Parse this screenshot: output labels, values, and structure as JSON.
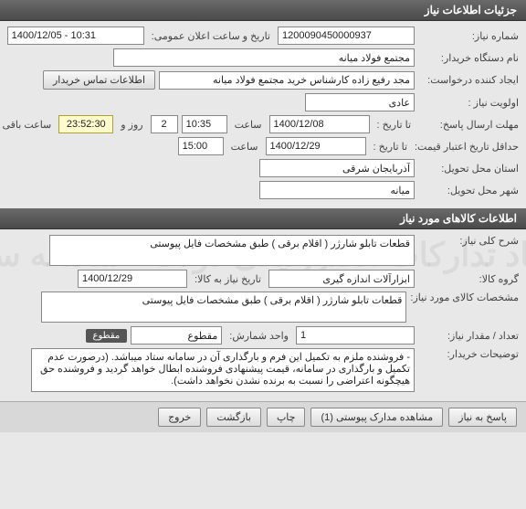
{
  "watermark": "ستاد تدارکات الکترونیکی دولت - سامانه ستاد",
  "header1": "جزئیات اطلاعات نیاز",
  "header2": "اطلاعات کالاهای مورد نیاز",
  "labels": {
    "need_no": "شماره نیاز:",
    "announce_dt": "تاریخ و ساعت اعلان عمومی:",
    "buyer_org": "نام دستگاه خریدار:",
    "requester": "ایجاد کننده درخواست:",
    "contact_btn": "اطلاعات تماس خریدار",
    "priority": "اولویت نیاز :",
    "resp_deadline": "مهلت ارسال پاسخ:",
    "until_date": "تا تاریخ :",
    "time": "ساعت",
    "days_and": "روز و",
    "remaining": "ساعت باقی مانده",
    "valid_until_lbl": "حداقل تاریخ اعتبار قیمت:",
    "valid_until_date": "تا تاریخ :",
    "delivery_province": "استان محل تحویل:",
    "delivery_city": "شهر محل تحویل:",
    "general_desc": "شرح کلی نیاز:",
    "goods_group": "گروه کالا:",
    "need_date": "تاریخ نیاز به کالا:",
    "item_spec": "مشخصات کالای مورد نیاز:",
    "qty": "تعداد / مقدار نیاز:",
    "unit": "واحد شمارش:",
    "cut": "مقطوع",
    "buyer_notes": "توضیحات خریدار:"
  },
  "values": {
    "need_no": "1200090450000937",
    "announce_dt": "1400/12/05 - 10:31",
    "buyer_org": "مجتمع فولاد میانه",
    "requester": "مجد رفیع زاده کارشناس خرید مجتمع فولاد میانه",
    "priority": "عادی",
    "resp_date": "1400/12/08",
    "resp_time": "10:35",
    "resp_days": "2",
    "resp_countdown": "23:52:30",
    "valid_date": "1400/12/29",
    "valid_time": "15:00",
    "province": "آذربایجان شرقی",
    "city": "میانه",
    "general_desc": "قطعات تابلو شارژر ( اقلام برقی ) طبق مشخصات فایل پیوستی",
    "goods_group": "ابزارآلات اندازه گیری",
    "need_date": "1400/12/29",
    "item_spec": "قطعات تابلو شارژر ( اقلام برقی ) طبق مشخصات فایل پیوستی",
    "qty": "1",
    "unit": "مقطوع",
    "buyer_notes": "- فروشنده ملزم به تکمیل این فرم و بارگذاری آن در سامانه ستاد میباشد. (درصورت عدم تکمیل و بارگذاری در سامانه، قیمت پیشنهادی فروشنده ابطال خواهد گردید و فروشنده حق هیچگونه اعتراضی را نسبت به برنده نشدن نخواهد داشت)."
  },
  "buttons": {
    "respond": "پاسخ به نیاز",
    "attachments": "مشاهده مدارک پیوستی (1)",
    "print": "چاپ",
    "back": "بازگشت",
    "exit": "خروج"
  }
}
